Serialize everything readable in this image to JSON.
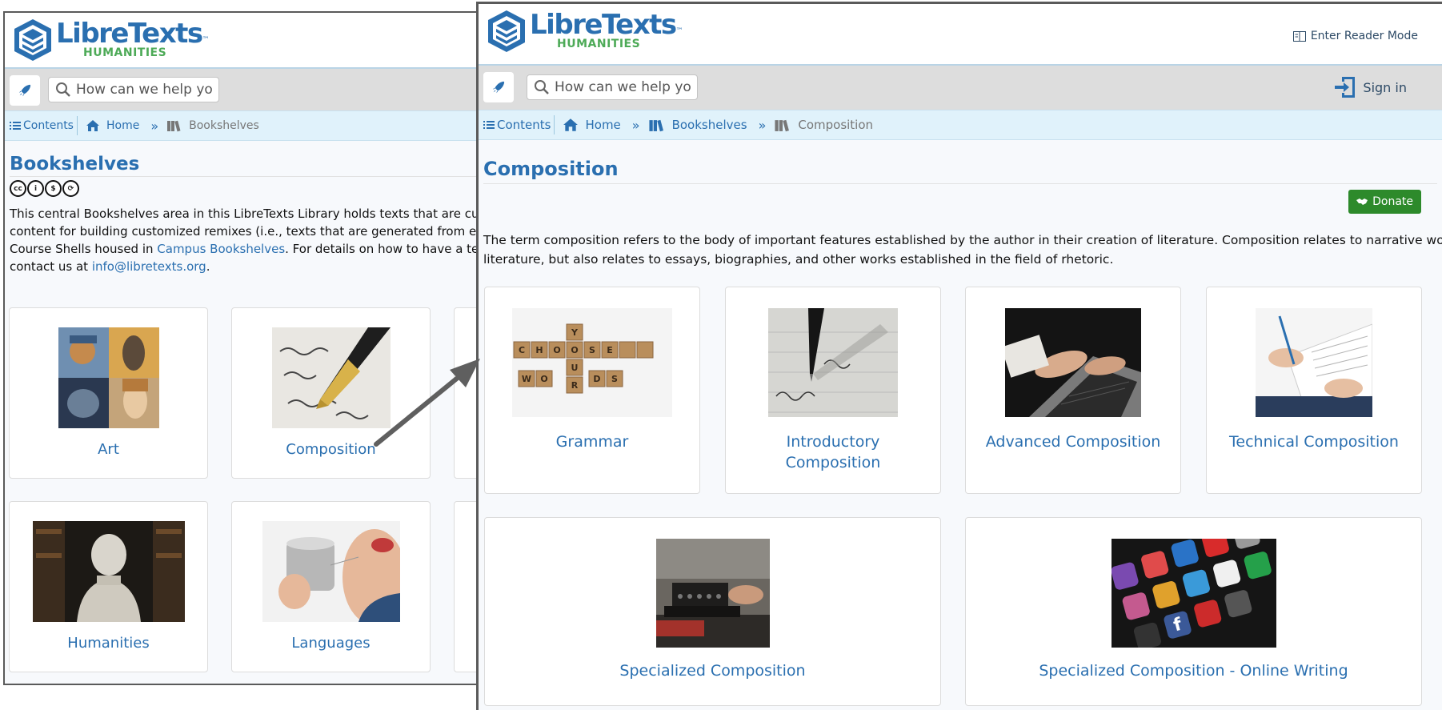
{
  "brand": {
    "name": "LibreTexts",
    "sub": "HUMANITIES",
    "tm": "™"
  },
  "back": {
    "search_placeholder": "How can we help you?",
    "breadcrumbs": {
      "contents": "Contents",
      "home": "Home",
      "current": "Bookshelves"
    },
    "title": "Bookshelves",
    "cc_icons": [
      "cc-icon",
      "by-icon",
      "nc-icon",
      "sa-icon"
    ],
    "desc": {
      "l1": "This central Bookshelves area in this LibreTexts Library holds texts that are curated by the",
      "l2": "content for building customized remixes (i.e., texts that are generated from existing conte",
      "l3a": "Course Shells housed in ",
      "l3link": "Campus Bookshelves",
      "l3b": ". For details on how to have a text added to",
      "l4a": "contact us at ",
      "l4link": "info@libretexts.org",
      "l4b": "."
    },
    "cards": [
      {
        "label": "Art"
      },
      {
        "label": "Composition"
      },
      {
        "label": "Humanities"
      },
      {
        "label": "Languages"
      }
    ]
  },
  "front": {
    "reader_mode": "Enter Reader Mode",
    "search_placeholder": "How can we help you?",
    "sign_in": "Sign in",
    "breadcrumbs": {
      "contents": "Contents",
      "home": "Home",
      "shelves": "Bookshelves",
      "current": "Composition"
    },
    "title": "Composition",
    "donate": "Donate",
    "desc": {
      "l1": "The term composition refers to the body of important features established by the author in their creation of literature. Composition relates to narrative works of",
      "l2": "literature, but also relates to essays, biographies, and other works established in the field of rhetoric."
    },
    "cards": [
      {
        "label": "Grammar"
      },
      {
        "label1": "Introductory",
        "label2": "Composition"
      },
      {
        "label": "Advanced Composition"
      },
      {
        "label": "Technical Composition"
      },
      {
        "label": "Specialized Composition"
      },
      {
        "label": "Specialized Composition - Online Writing"
      }
    ]
  },
  "colors": {
    "link": "#2a6fb0",
    "accent_green": "#4daa57",
    "donate": "#2d8a2b",
    "crumb_bg": "#e0f2fb"
  }
}
